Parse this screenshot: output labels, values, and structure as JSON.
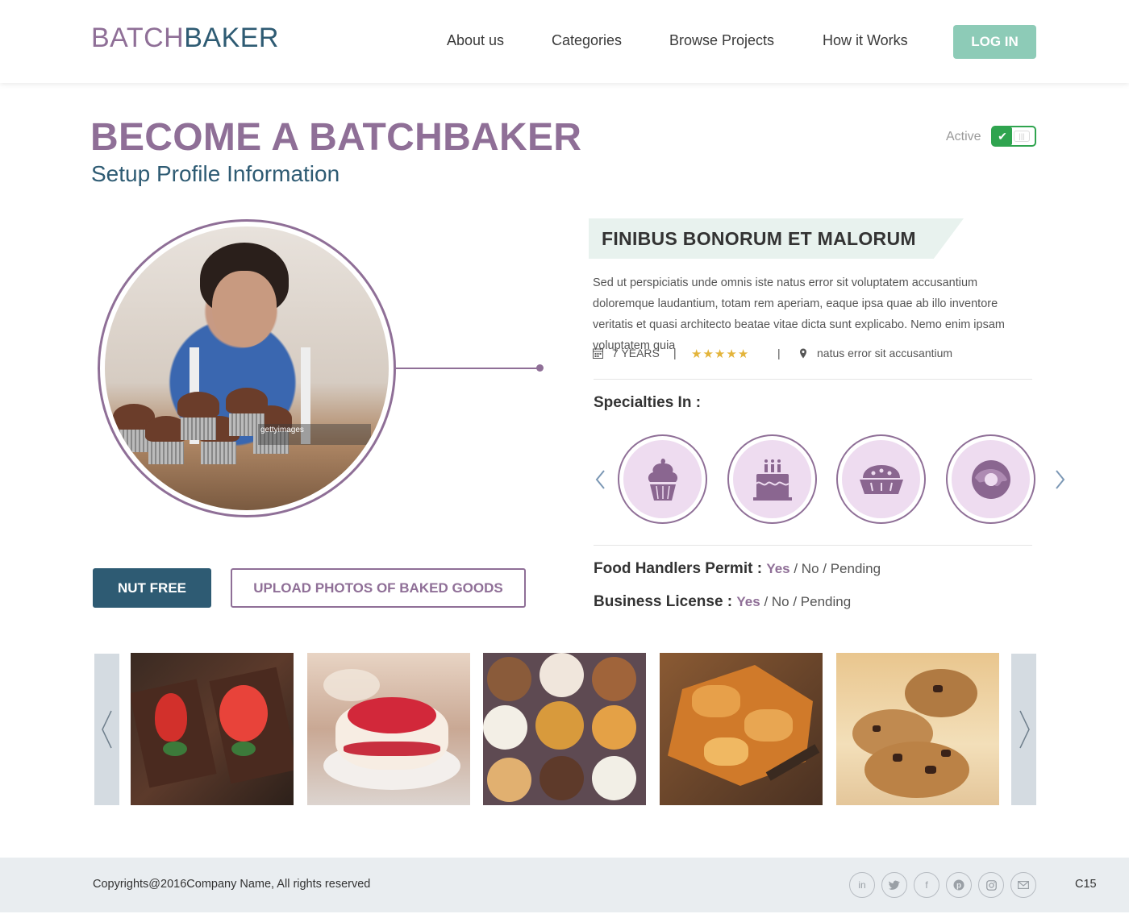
{
  "header": {
    "logo_part1": "BATCH",
    "logo_part2": "BAKER",
    "nav": [
      "About us",
      "Categories",
      "Browse Projects",
      "How it Works"
    ],
    "login_label": "LOG IN"
  },
  "page": {
    "title": "BECOME A BATCHBAKER",
    "subtitle": "Setup Profile Information",
    "status_label": "Active",
    "status_active": true
  },
  "profile": {
    "photo_watermark": "gettyimages",
    "section_title": "FINIBUS BONORUM ET MALORUM",
    "description": "Sed ut perspiciatis unde omnis iste natus error sit voluptatem accusantium doloremque laudantium, totam rem aperiam, eaque ipsa quae ab illo inventore veritatis et quasi architecto beatae vitae dicta sunt explicabo. Nemo enim ipsam voluptatem quia",
    "experience": "7 YEARS",
    "separator": "|",
    "rating": 5,
    "rating_max": 5,
    "location": "natus error sit  accusantium"
  },
  "specialties": {
    "heading": "Specialties In :",
    "items": [
      "cupcake-icon",
      "birthday-cake-icon",
      "pie-icon",
      "donut-icon"
    ]
  },
  "permits": [
    {
      "label": "Food Handlers Permit :",
      "yes": "Yes",
      "rest": " / No / Pending"
    },
    {
      "label": "Business License :",
      "yes": "Yes",
      "rest": " / No / Pending"
    }
  ],
  "buttons": {
    "nut_free": "NUT FREE",
    "upload": "UPLOAD PHOTOS OF BAKED GOODS"
  },
  "gallery": [
    "strawberry-brownies",
    "berry-pavlova",
    "decorated-cupcakes",
    "pastry-pie",
    "chocolate-chip-cookies"
  ],
  "footer": {
    "copyright": "Copyrights@2016Company Name, All rights reserved",
    "social": [
      "linkedin-icon",
      "twitter-icon",
      "facebook-icon",
      "pinterest-icon",
      "instagram-icon",
      "email-icon"
    ],
    "page_code": "C15"
  },
  "colors": {
    "brand_purple": "#8f6f97",
    "brand_blue": "#2e5b73",
    "login_green": "#8dcbb7",
    "toggle_green": "#2fa44f",
    "star_gold": "#e3b43b"
  }
}
